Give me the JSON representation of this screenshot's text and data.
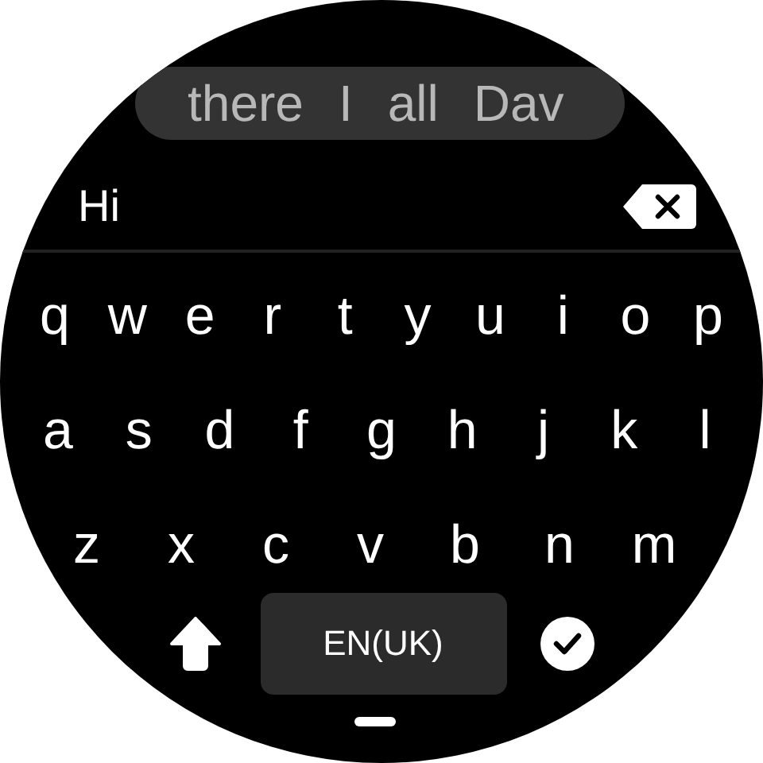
{
  "suggestions": [
    "there",
    "I",
    "all",
    "Dav"
  ],
  "input": {
    "value": "Hi"
  },
  "key_rows": [
    [
      "q",
      "w",
      "e",
      "r",
      "t",
      "y",
      "u",
      "i",
      "o",
      "p"
    ],
    [
      "a",
      "s",
      "d",
      "f",
      "g",
      "h",
      "j",
      "k",
      "l"
    ],
    [
      "z",
      "x",
      "c",
      "v",
      "b",
      "n",
      "m"
    ]
  ],
  "language_key": "EN(UK)"
}
